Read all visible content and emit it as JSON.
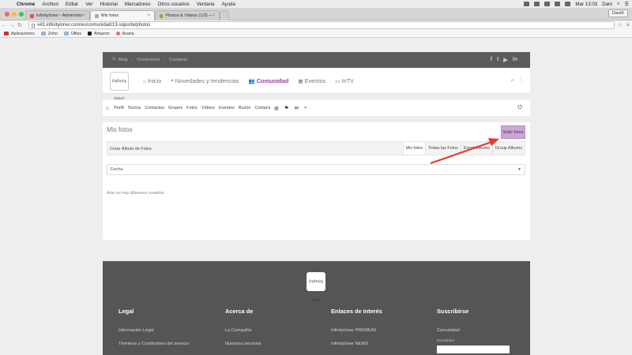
{
  "menubar": {
    "app": "Chrome",
    "items": [
      "Archivo",
      "Editar",
      "Ver",
      "Historial",
      "Marcadores",
      "Otros usuarios",
      "Ventana",
      "Ayuda"
    ],
    "clock": "Mar 13:03",
    "user": "Dani"
  },
  "tabs": [
    {
      "title": "InfinityInner - Administrac",
      "active": false
    },
    {
      "title": "Mis fotos",
      "active": true
    },
    {
      "title": "Photos & Videos (1/3) — ad",
      "active": false
    }
  ],
  "profile_button": "DaniK",
  "address": {
    "url": "v43.infinityinner.com/es/comunidad/13-soporte/photos"
  },
  "bookmarks": [
    "Aplicaciones",
    "Zoho",
    "Útiles",
    "Amazon",
    "Asana"
  ],
  "site": {
    "topbar": {
      "links": [
        "Blog",
        "Conócenos",
        "Contacto"
      ],
      "social": [
        "f",
        "t",
        "yt",
        "in"
      ]
    },
    "logo_text": "Infinity inner",
    "nav": [
      {
        "label": "Inicio",
        "icon": "home-icon",
        "active": false
      },
      {
        "label": "Novedades y tendencias",
        "icon": "quote-icon",
        "active": false
      },
      {
        "label": "Comunidad",
        "icon": "users-icon",
        "active": true
      },
      {
        "label": "Eventos",
        "icon": "calendar-icon",
        "active": false
      },
      {
        "label": "InTV",
        "icon": "tv-icon",
        "active": false
      }
    ],
    "subnav": [
      "Perfil",
      "Socios",
      "Contactos",
      "Grupos",
      "Fotos",
      "Vídeos",
      "Eventos",
      "Buzón",
      "Compra"
    ],
    "page_title": "Mis fotos",
    "upload_button": "Subir fotos",
    "create_album": "Crear Álbum de Fotos",
    "photo_tabs": [
      "Mis fotos",
      "Todas las Fotos",
      "Event Albums",
      "Group Albums"
    ],
    "sort_select": "Fecha",
    "empty_message": "Aún no hay álbumes creados.",
    "footer": {
      "columns": [
        {
          "title": "Legal",
          "links": [
            "Información Legal",
            "Términos y Condiciones del servicio"
          ]
        },
        {
          "title": "Acerca de",
          "links": [
            "La Compañía",
            "Nuestros servicios"
          ]
        },
        {
          "title": "Enlaces de Interés",
          "links": [
            "InfinityInner PREMIUM",
            "InfinityInner NEWS"
          ]
        },
        {
          "title": "Suscribirse",
          "links": [
            "Comunidad"
          ],
          "newsletter_label": "Newsletter"
        }
      ]
    }
  },
  "colors": {
    "accent": "#9b3fa3",
    "upload_button_bg": "#c9a8d4",
    "dark_bar": "#5a5b5d",
    "arrow": "#e53935"
  }
}
